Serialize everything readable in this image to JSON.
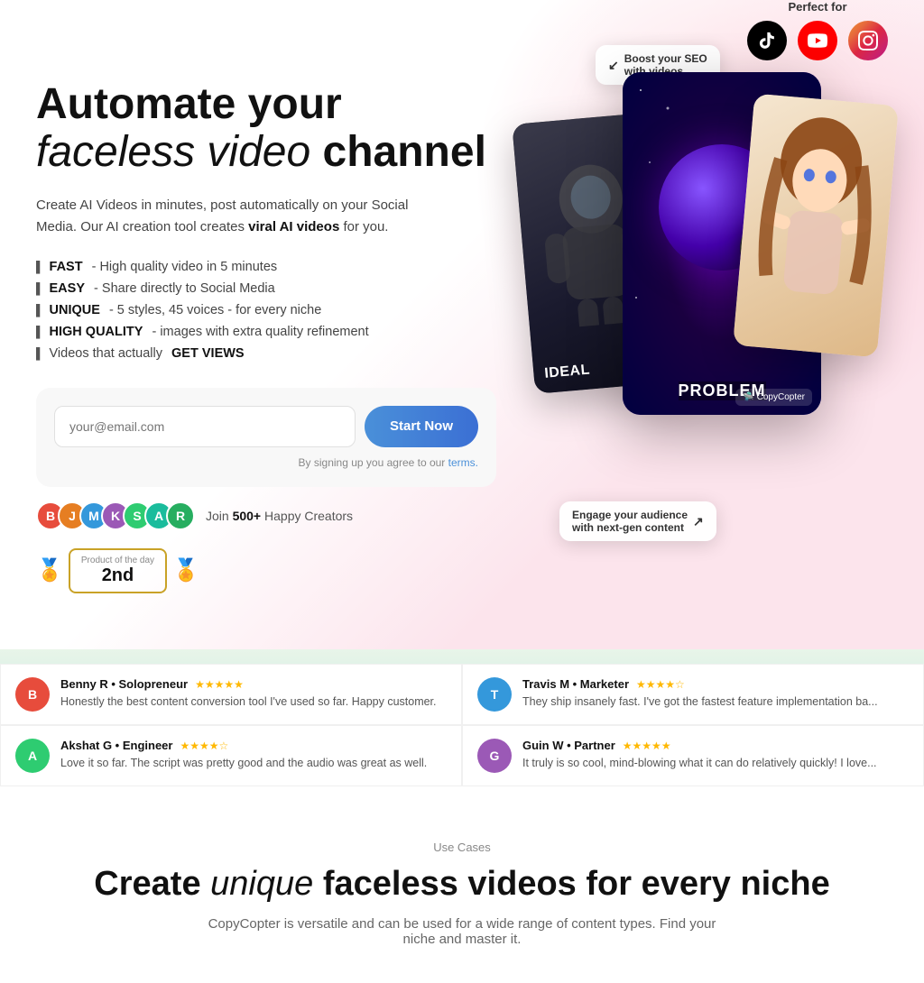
{
  "hero": {
    "perfect_for": "Perfect for",
    "headline_line1": "Automate your",
    "headline_line2_italic": "faceless video",
    "headline_line2_bold": "channel",
    "description": "Create AI Videos in minutes, post automatically on your Social Media. Our AI creation tool creates ",
    "description_highlight": "viral AI videos",
    "description_end": " for you.",
    "features": [
      {
        "bold": "FAST",
        "text": " - High quality video in 5 minutes"
      },
      {
        "bold": "EASY",
        "text": " - Share directly to Social Media"
      },
      {
        "bold": "UNIQUE",
        "text": " - 5 styles, 45 voices - for every niche"
      },
      {
        "bold": "HIGH QUALITY",
        "text": " - images with extra quality refinement"
      },
      {
        "bold": "",
        "text": "Videos that actually ",
        "bold2": "GET VIEWS"
      }
    ],
    "email_placeholder": "your@email.com",
    "start_button": "Start Now",
    "terms_text": "By signing up you agree to our",
    "terms_link": "terms.",
    "social_proof_text": "Join ",
    "social_proof_count": "500+",
    "social_proof_rest": " Happy Creators",
    "product_badge_top": "Product of the day",
    "product_badge_num": "2nd",
    "float_seo": "Boost your SEO\nwith videos",
    "float_engage": "Engage your audience\nwith next-gen content",
    "card_main_label": "PROBLEM",
    "card_left_label": "IDEAL",
    "card_logo": "🛸 CopyCopter"
  },
  "social_icons": [
    {
      "name": "TikTok",
      "symbol": "♪"
    },
    {
      "name": "YouTube",
      "symbol": "▶"
    },
    {
      "name": "Instagram",
      "symbol": "📷"
    }
  ],
  "reviews": [
    {
      "name": "Benny R",
      "role": "Solopreneur",
      "stars": "★★★★★",
      "text": "Honestly the best content conversion tool I've used so far. Happy customer.",
      "initials": "B"
    },
    {
      "name": "Travis M",
      "role": "Marketer",
      "stars": "★★★★☆",
      "text": "They ship insanely fast. I've got the fastest feature implementation ba...",
      "initials": "T"
    },
    {
      "name": "Akshat G",
      "role": "Engineer",
      "stars": "★★★★☆",
      "text": "Love it so far. The script was pretty good and the audio was great as well.",
      "initials": "A"
    },
    {
      "name": "Guin W",
      "role": "Partner",
      "stars": "★★★★★",
      "text": "It truly is so cool, mind-blowing what it can do relatively quickly! I love...",
      "initials": "G"
    }
  ],
  "use_cases": {
    "label": "Use Cases",
    "headline_bold1": "Create",
    "headline_italic": "unique",
    "headline_bold2": "faceless videos for every niche",
    "description": "CopyCopter is versatile and can be used for a wide range of content types. Find your niche and master it."
  }
}
